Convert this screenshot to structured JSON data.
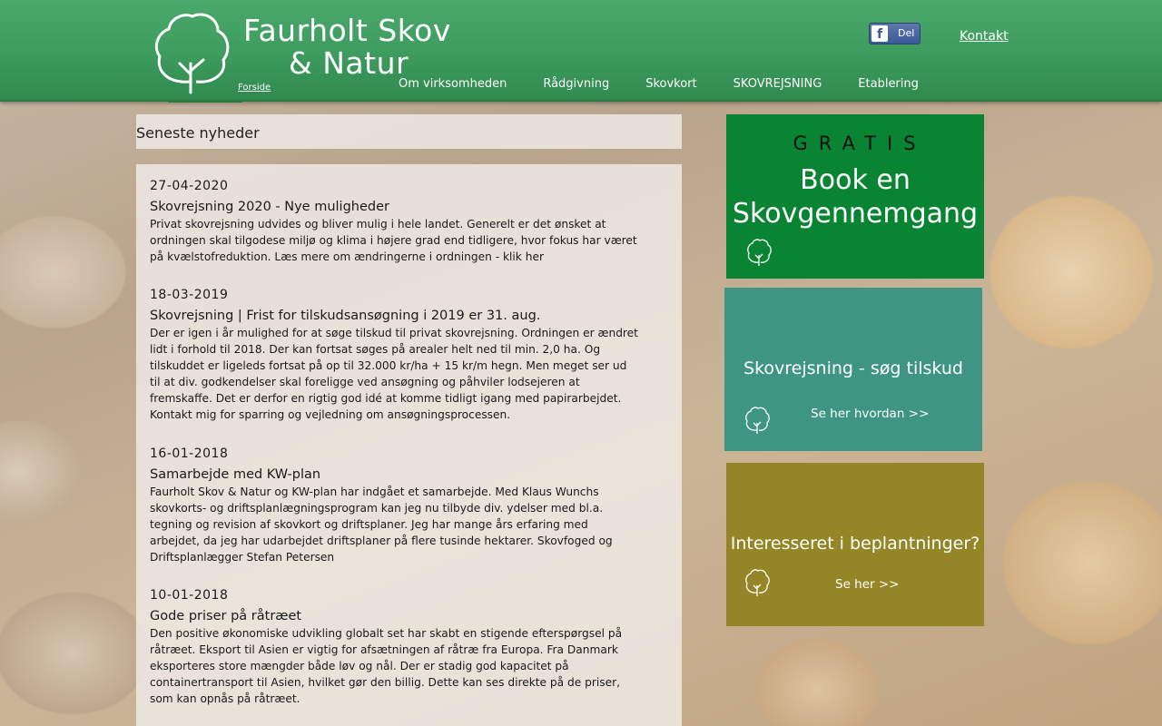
{
  "header": {
    "logo_line1": "Faurholt Skov",
    "logo_line2": "& Natur",
    "breadcrumb": "Forside",
    "facebook_share": "Del",
    "contact_link": "Kontakt",
    "nav": [
      "Om virksomheden",
      "Rådgivning",
      "Skovkort",
      "SKOVREJSNING",
      "Etablering"
    ]
  },
  "news": {
    "section_title": "Seneste nyheder",
    "items": [
      {
        "date": "27-04-2020",
        "headline": "Skovrejsning 2020 - Nye muligheder",
        "body": "Privat skovrejsning udvides og bliver mulig i hele landet. Generelt er det ønsket at ordningen skal tilgodese miljø og klima i højere grad end tidligere, hvor fokus har været på kvælstofreduktion. Læs mere om ændringerne i ordningen - klik her"
      },
      {
        "date": "18-03-2019",
        "headline": "Skovrejsning | Frist for tilskudsansøgning i 2019 er 31. aug.",
        "body": "Der er igen i år mulighed for at søge tilskud til privat skovrejsning. Ordningen er ændret lidt i forhold til 2018. Der kan fortsat søges på arealer helt ned til min. 2,0 ha. Og tilskuddet er ligeleds fortsat på op til 32.000 kr/ha + 15 kr/m hegn. Men meget ser ud til at div. godkendelser skal foreligge ved ansøgning og påhviler lodsejeren at fremskaffe. Det er derfor en rigtig god idé at komme tidligt igang med papirarbejdet. Kontakt mig for sparring og vejledning om ansøgningsprocessen."
      },
      {
        "date": "16-01-2018",
        "headline": "Samarbejde med KW-plan",
        "body": "Faurholt Skov & Natur og KW-plan har indgået et samarbejde. Med Klaus Wunchs skovkorts- og driftsplanlægningsprogram kan jeg nu tilbyde div. ydelser med bl.a. tegning og revision af skovkort og driftsplaner. Jeg har mange års erfaring med arbejdet, da jeg har udarbejdet driftsplaner på flere tusinde hektarer. Skovfoged og Driftsplanlægger Stefan Petersen"
      },
      {
        "date": "10-01-2018",
        "headline": "Gode priser på råtræet",
        "body": "Den positive økonomiske udvikling globalt set har skabt en stigende efterspørgsel på råtræet. Eksport til Asien er vigtig for afsætningen af råtræ fra Europa. Fra Danmark eksporteres store mængder både løv og nål. Der er stadig god kapacitet på containertransport til Asien, hvilket gør den billig. Dette kan ses direkte på de priser, som kan opnås på råtræet."
      }
    ]
  },
  "sidebar": {
    "box1": {
      "tag": "GRATIS",
      "line1": "Book en",
      "line2": "Skovgennemgang",
      "color": "#098432"
    },
    "box2": {
      "title": "Skovrejsning - søg tilskud",
      "link": "Se her hvordan >>",
      "color": "#3f9584"
    },
    "box3": {
      "title": "Interesseret i beplantninger?",
      "link": "Se her >>",
      "color": "#948526"
    }
  }
}
